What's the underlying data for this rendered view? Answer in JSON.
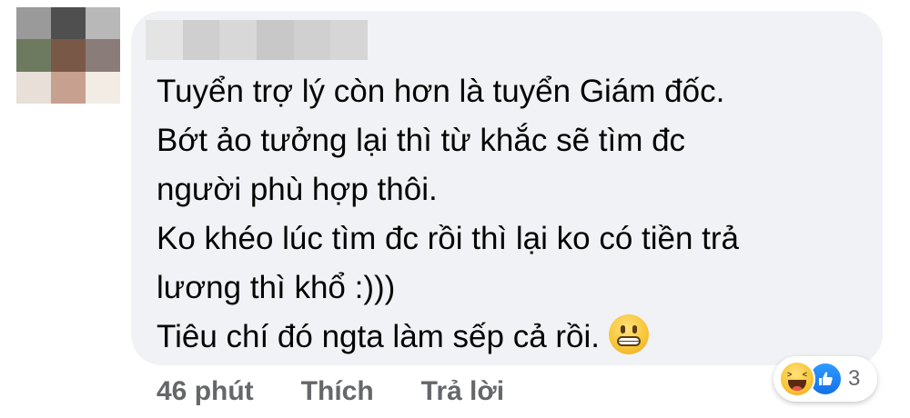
{
  "comment": {
    "author_blurred": true,
    "lines": [
      "Tuyển trợ lý còn hơn là tuyển Giám đốc.",
      "Bớt ảo tưởng lại thì từ khắc sẽ tìm đc",
      "người phù hợp thôi.",
      "Ko khéo lúc tìm đc rồi thì lại ko có tiền trả",
      "lương thì khổ :)))",
      "Tiêu chí đó ngta làm sếp cả rồi."
    ],
    "trailing_emoji": "grimacing-face-emoji"
  },
  "actions": {
    "time": "46 phút",
    "like_label": "Thích",
    "reply_label": "Trả lời"
  },
  "reactions": {
    "icons": [
      "haha-reaction-icon",
      "like-reaction-icon"
    ],
    "count": "3"
  },
  "colors": {
    "bubble_bg": "#f0f2f5",
    "meta_text": "#65676b",
    "like_blue": "#1877f2"
  },
  "avatar_pixel_colors": [
    "#9a9a9a",
    "#4f4f4f",
    "#b8b8b8",
    "#6d7a60",
    "#7a5848",
    "#8a7c78",
    "#e8e0d8",
    "#c8a090",
    "#f2ece4"
  ],
  "author_pixel_colors": [
    "#e4e4e4",
    "#cfcfcf",
    "#d8d8d8",
    "#c8c8c8",
    "#d0d0d0",
    "#d6d6d6"
  ]
}
